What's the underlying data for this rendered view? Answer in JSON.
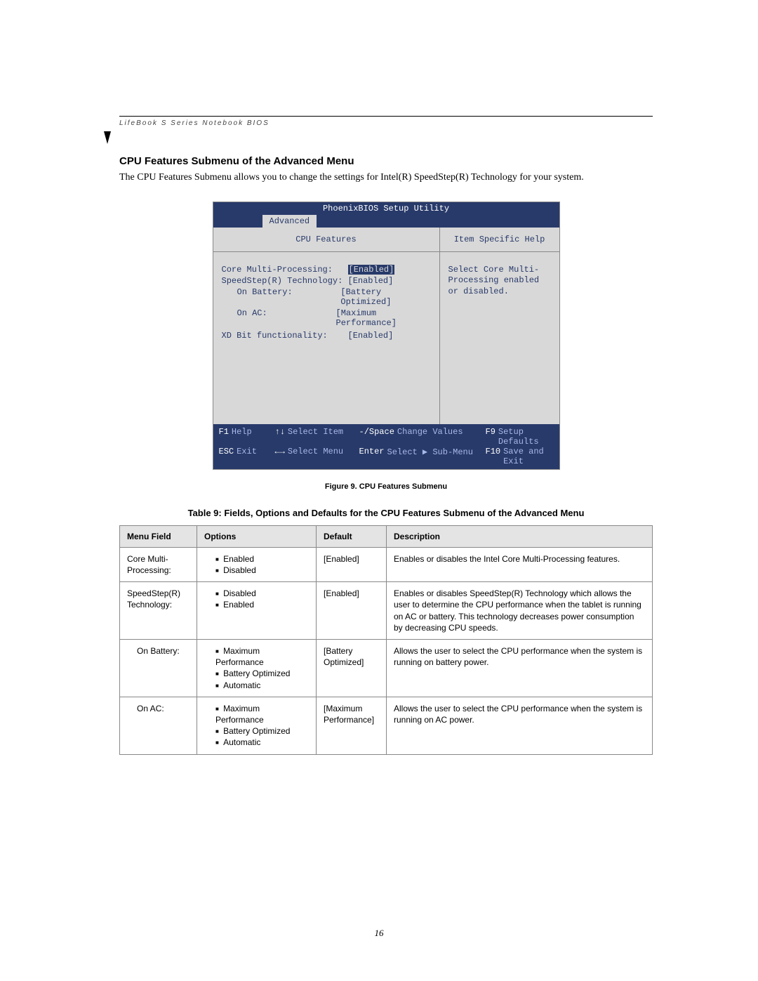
{
  "header": {
    "running_head": "LifeBook S Series Notebook BIOS"
  },
  "section": {
    "title": "CPU Features Submenu of the Advanced Menu",
    "intro": "The CPU Features Submenu allows you to change the settings for Intel(R) SpeedStep(R) Technology for your system."
  },
  "bios": {
    "title": "PhoenixBIOS Setup Utility",
    "active_tab": "Advanced",
    "submenu_title": "CPU Features",
    "help_title": "Item Specific Help",
    "help_text": "Select Core Multi-Processing enabled or disabled.",
    "settings": [
      {
        "label": "Core Multi-Processing:",
        "value": "[Enabled]",
        "selected": true,
        "indent": false
      },
      {
        "label": "SpeedStep(R) Technology:",
        "value": "[Enabled]",
        "selected": false,
        "indent": false
      },
      {
        "label": "On Battery:",
        "value": "[Battery Optimized]",
        "selected": false,
        "indent": true
      },
      {
        "label": "On AC:",
        "value": "[Maximum Performance]",
        "selected": false,
        "indent": true
      },
      {
        "label": "",
        "value": "",
        "selected": false,
        "indent": false
      },
      {
        "label": "XD Bit functionality:",
        "value": "[Enabled]",
        "selected": false,
        "indent": false
      }
    ],
    "footer": {
      "r1": {
        "k1": "F1",
        "h1": "Help",
        "k2": "↑↓",
        "h2": "Select Item",
        "k3": "-/Space",
        "h3": "Change Values",
        "k4": "F9",
        "h4": "Setup Defaults"
      },
      "r2": {
        "k1": "ESC",
        "h1": "Exit",
        "k2": "←→",
        "h2": "Select Menu",
        "k3": "Enter",
        "h3": "Select ▶ Sub-Menu",
        "k4": "F10",
        "h4": "Save and Exit"
      }
    }
  },
  "figure_caption": "Figure 9.  CPU Features Submenu",
  "table": {
    "title": "Table 9: Fields, Options and Defaults for the CPU Features Submenu of the Advanced Menu",
    "headers": [
      "Menu Field",
      "Options",
      "Default",
      "Description"
    ],
    "rows": [
      {
        "field": "Core Multi-Processing:",
        "indent": false,
        "options": [
          "Enabled",
          "Disabled"
        ],
        "default": "[Enabled]",
        "desc": "Enables or disables the Intel Core Multi-Processing features."
      },
      {
        "field": "SpeedStep(R) Technology:",
        "indent": false,
        "options": [
          "Disabled",
          "Enabled"
        ],
        "default": "[Enabled]",
        "desc": "Enables or disables SpeedStep(R) Technology which allows the user to determine the CPU performance when the tablet is running on AC or battery. This technology decreases power consumption by decreasing CPU speeds."
      },
      {
        "field": "On Battery:",
        "indent": true,
        "options": [
          "Maximum Performance",
          "Battery Optimized",
          "Automatic"
        ],
        "default": "[Battery Optimized]",
        "desc": "Allows the user to select the CPU performance when the system is running on battery power."
      },
      {
        "field": "On AC:",
        "indent": true,
        "options": [
          "Maximum Performance",
          "Battery Optimized",
          "Automatic"
        ],
        "default": "[Maximum Performance]",
        "desc": "Allows the user to select the CPU performance when the system is running on AC power."
      }
    ]
  },
  "page_number": "16"
}
